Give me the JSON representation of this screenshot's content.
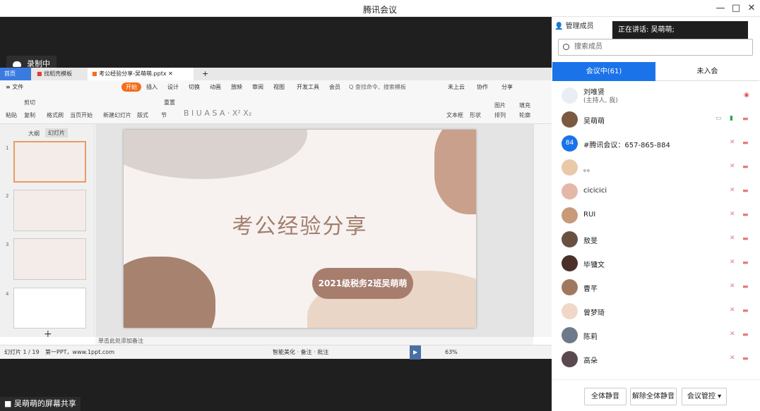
{
  "app": {
    "title": "腾讯会议",
    "minimize": "—",
    "maximize": "□",
    "close": "✕"
  },
  "recording": {
    "label": "录制中"
  },
  "share_bar": {
    "label": "吴萌萌的屏幕共享"
  },
  "wps": {
    "tabs": [
      "首页",
      "找稻壳模板",
      "考公经验分享-吴萌萌.pptx"
    ],
    "menus": [
      "≡ 文件",
      "开始",
      "插入",
      "设计",
      "切换",
      "动画",
      "放映",
      "审阅",
      "视图",
      "开发工具",
      "会员",
      "Q 查找命令、搜索模板",
      "未上云",
      "协作",
      "分享"
    ],
    "tools": [
      "粘贴",
      "剪切",
      "复制",
      "格式刷",
      "当页开始",
      "新建幻灯片",
      "版式",
      "节",
      "重置",
      "文本框",
      "形状",
      "排列",
      "图片",
      "填充",
      "轮廓"
    ],
    "panel_tabs": [
      "大纲",
      "幻灯片"
    ],
    "slides": [
      "1",
      "2",
      "3",
      "4"
    ],
    "slide_title": "考公经验分享",
    "slide_subtitle": "2021级税务2班吴萌萌",
    "notes": "单击此处添加备注",
    "status_left": "幻灯片 1 / 19",
    "status_theme": "第一PPT，www.1ppt.com",
    "status_tools": "智能美化 · 备注 · 批注",
    "zoom": "63%"
  },
  "panel": {
    "title": "管理成员",
    "speaker": "正在讲话: 吴萌萌;",
    "search_placeholder": "搜索成员",
    "tab_in": "会议中(61)",
    "tab_out": "未入会",
    "members": [
      {
        "name": "刘唯贤",
        "sub": "(主持人, 我)"
      },
      {
        "name": "吴萌萌"
      },
      {
        "name": "#腾讯会议：657-865-884",
        "badge": "84"
      },
      {
        "name": "。。"
      },
      {
        "name": "cicicici"
      },
      {
        "name": "RUI"
      },
      {
        "name": "敖旻"
      },
      {
        "name": "毕镛文"
      },
      {
        "name": "曹芊"
      },
      {
        "name": "曾梦琦"
      },
      {
        "name": "陈莉"
      },
      {
        "name": "高朵"
      }
    ],
    "mute_all": "全体静音",
    "unmute_all": "解除全体静音",
    "control": "会议管控 ▾"
  }
}
